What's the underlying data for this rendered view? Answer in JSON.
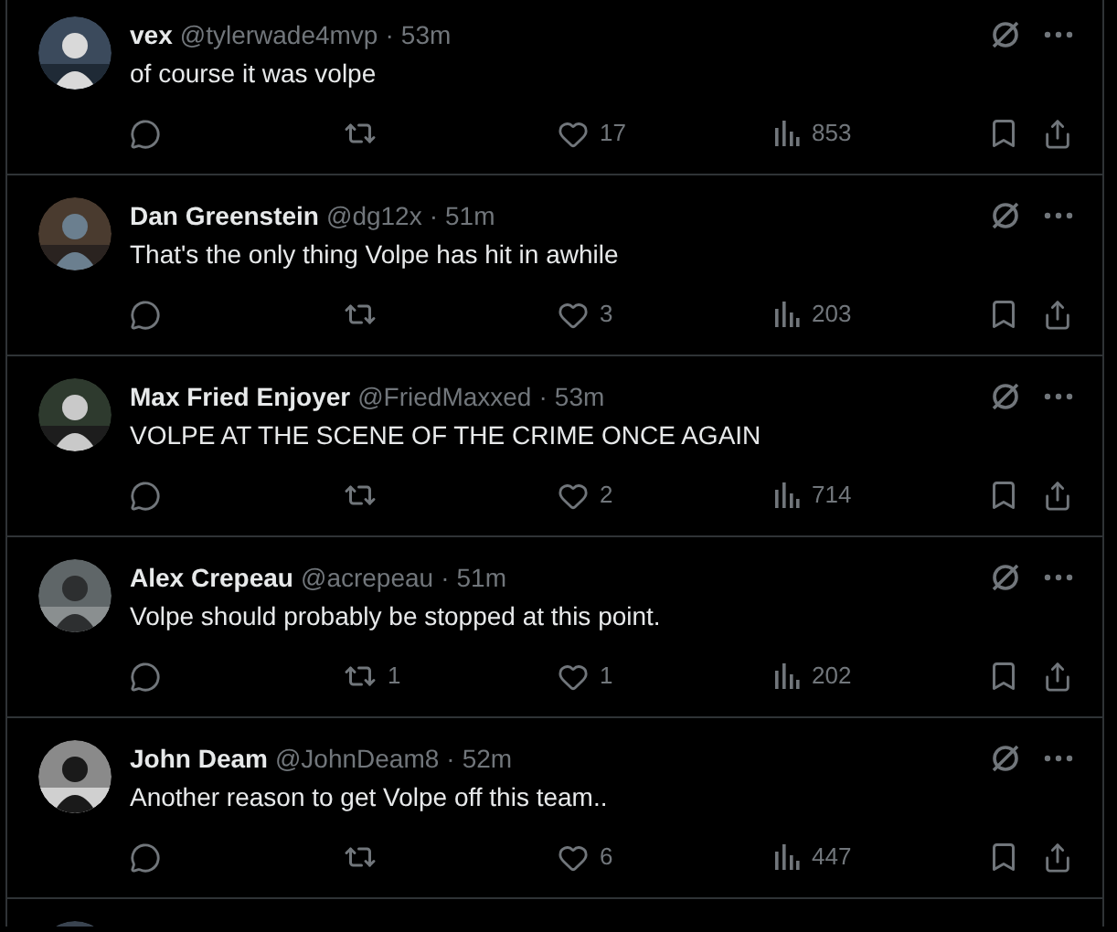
{
  "replies": [
    {
      "name": "vex",
      "handle": "@tylerwade4mvp",
      "time": "53m",
      "text": "of course it was volpe",
      "likes": "17",
      "views": "853"
    },
    {
      "name": "Dan Greenstein",
      "handle": "@dg12x",
      "time": "51m",
      "text": "That's the only thing Volpe has hit in awhile",
      "likes": "3",
      "views": "203"
    },
    {
      "name": "Max Fried Enjoyer",
      "handle": "@FriedMaxxed",
      "time": "53m",
      "text": "VOLPE AT THE SCENE OF THE CRIME ONCE AGAIN",
      "likes": "2",
      "views": "714"
    },
    {
      "name": "Alex Crepeau",
      "handle": "@acrepeau",
      "time": "51m",
      "text": "Volpe should probably be stopped at this point.",
      "reposts": "1",
      "likes": "1",
      "views": "202"
    },
    {
      "name": "John Deam",
      "handle": "@JohnDeam8",
      "time": "52m",
      "text": "Another reason to get Volpe off this team..",
      "likes": "6",
      "views": "447"
    }
  ],
  "separator": "·"
}
